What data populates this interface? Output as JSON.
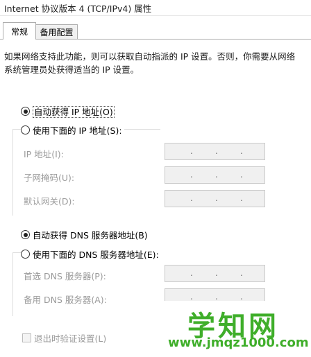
{
  "window": {
    "title": "Internet 协议版本 4 (TCP/IPv4) 属性"
  },
  "tabs": [
    {
      "label": "常规",
      "active": true
    },
    {
      "label": "备用配置",
      "active": false
    }
  ],
  "description": "如果网络支持此功能，则可以获取自动指派的 IP 设置。否则，你需要从网络系统管理员处获得适当的 IP 设置。",
  "ip_section": {
    "auto_radio": {
      "label": "自动获得 IP 地址(O)",
      "checked": true
    },
    "manual_radio": {
      "label": "使用下面的 IP 地址(S):",
      "checked": false
    },
    "fields": [
      {
        "label": "IP 地址(I):",
        "value": ". . ."
      },
      {
        "label": "子网掩码(U):",
        "value": ". . ."
      },
      {
        "label": "默认网关(D):",
        "value": ". . ."
      }
    ]
  },
  "dns_section": {
    "auto_radio": {
      "label": "自动获得 DNS 服务器地址(B)",
      "checked": true
    },
    "manual_radio": {
      "label": "使用下面的 DNS 服务器地址(E):",
      "checked": false
    },
    "fields": [
      {
        "label": "首选 DNS 服务器(P):",
        "value": ". . ."
      },
      {
        "label": "备用 DNS 服务器(A):",
        "value": ". . ."
      }
    ]
  },
  "validate_checkbox": {
    "label": "退出时验证设置(L)",
    "checked": false
  },
  "watermark": {
    "brand": "学知网",
    "url": "www.jmqz1000.com"
  },
  "colors": {
    "watermark_green": "#3fae2a",
    "disabled_text": "#9b9b9b",
    "field_bg": "#f0f0f0"
  }
}
